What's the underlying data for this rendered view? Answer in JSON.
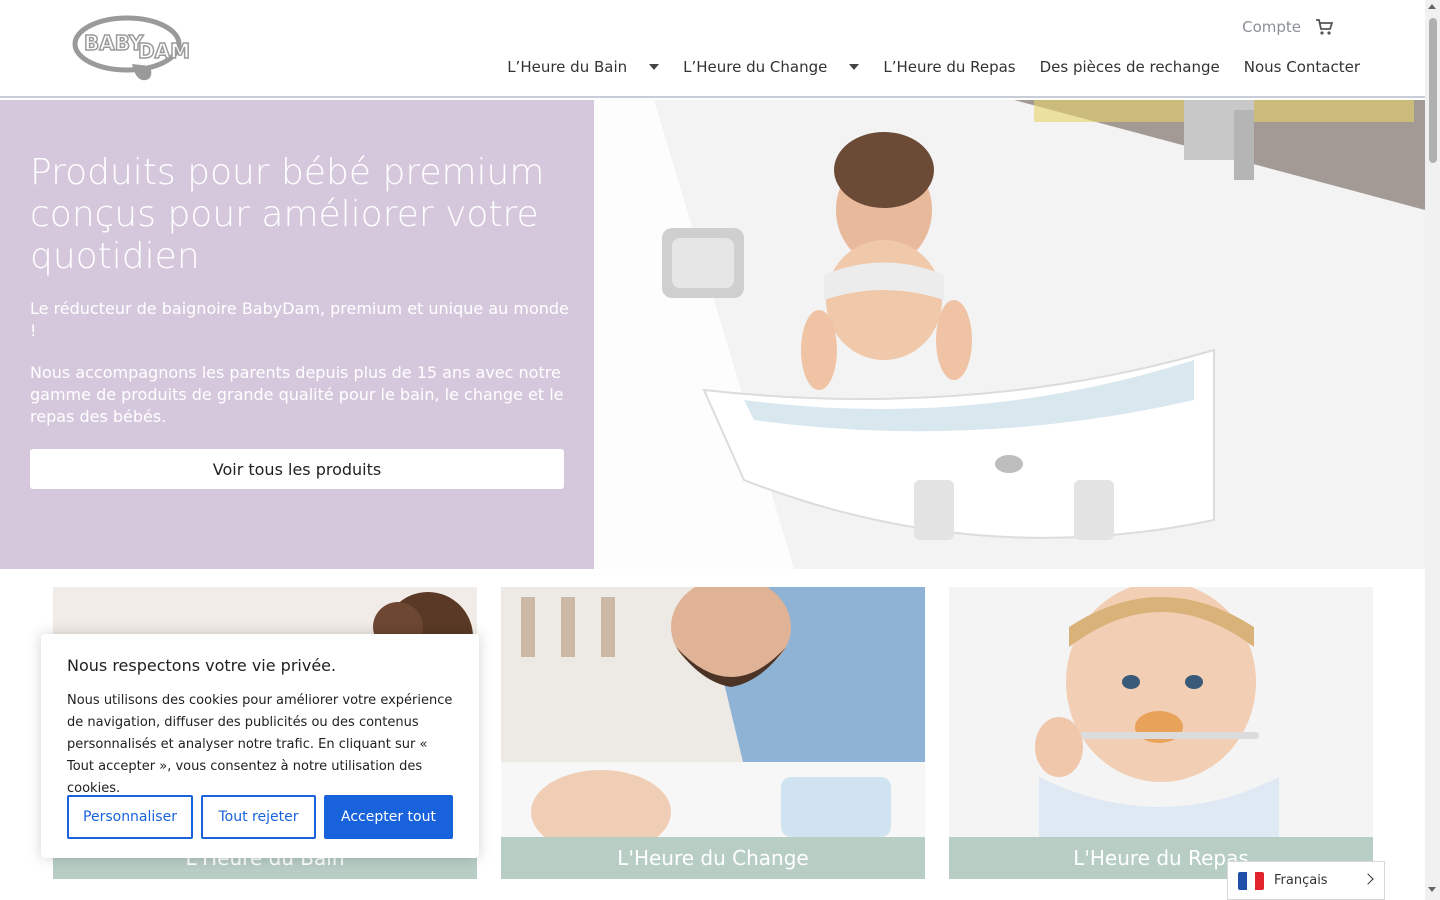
{
  "header": {
    "logo_text": "BABY DAM",
    "account": "Compte",
    "cart_icon": "cart-icon"
  },
  "nav": {
    "items": [
      {
        "label": "L’Heure du Bain",
        "has_dropdown": true
      },
      {
        "label": "L’Heure du Change",
        "has_dropdown": true
      },
      {
        "label": "L’Heure du Repas",
        "has_dropdown": false
      },
      {
        "label": "Des pièces de rechange",
        "has_dropdown": false
      },
      {
        "label": "Nous Contacter",
        "has_dropdown": false
      }
    ]
  },
  "hero": {
    "title": "Produits pour bébé premium conçus pour améliorer votre quotidien",
    "subtitle1": "Le réducteur de baignoire BabyDam, premium et unique au monde !",
    "subtitle2": "Nous accompagnons les parents depuis plus de 15 ans avec notre gamme de produits de grande qualité pour le bain, le change et le repas des bébés.",
    "button": "Voir tous les produits"
  },
  "cards": [
    {
      "caption": "L'Heure du Bain"
    },
    {
      "caption": "L'Heure du Change"
    },
    {
      "caption": "L'Heure du Repas"
    }
  ],
  "cookie": {
    "title": "Nous respectons votre vie privée.",
    "text": "Nous utilisons des cookies pour améliorer votre expérience de navigation, diffuser des publicités ou des contenus personnalisés et analyser notre trafic. En cliquant sur « Tout accepter », vous consentez à notre utilisation des cookies.",
    "customize": "Personnaliser",
    "reject": "Tout rejeter",
    "accept": "Accepter tout"
  },
  "language": {
    "label": "Français"
  },
  "colors": {
    "hero_bg": "#d5c8dc",
    "card_caption_bg": "#b8cec5",
    "accent_blue": "#1863dc"
  }
}
